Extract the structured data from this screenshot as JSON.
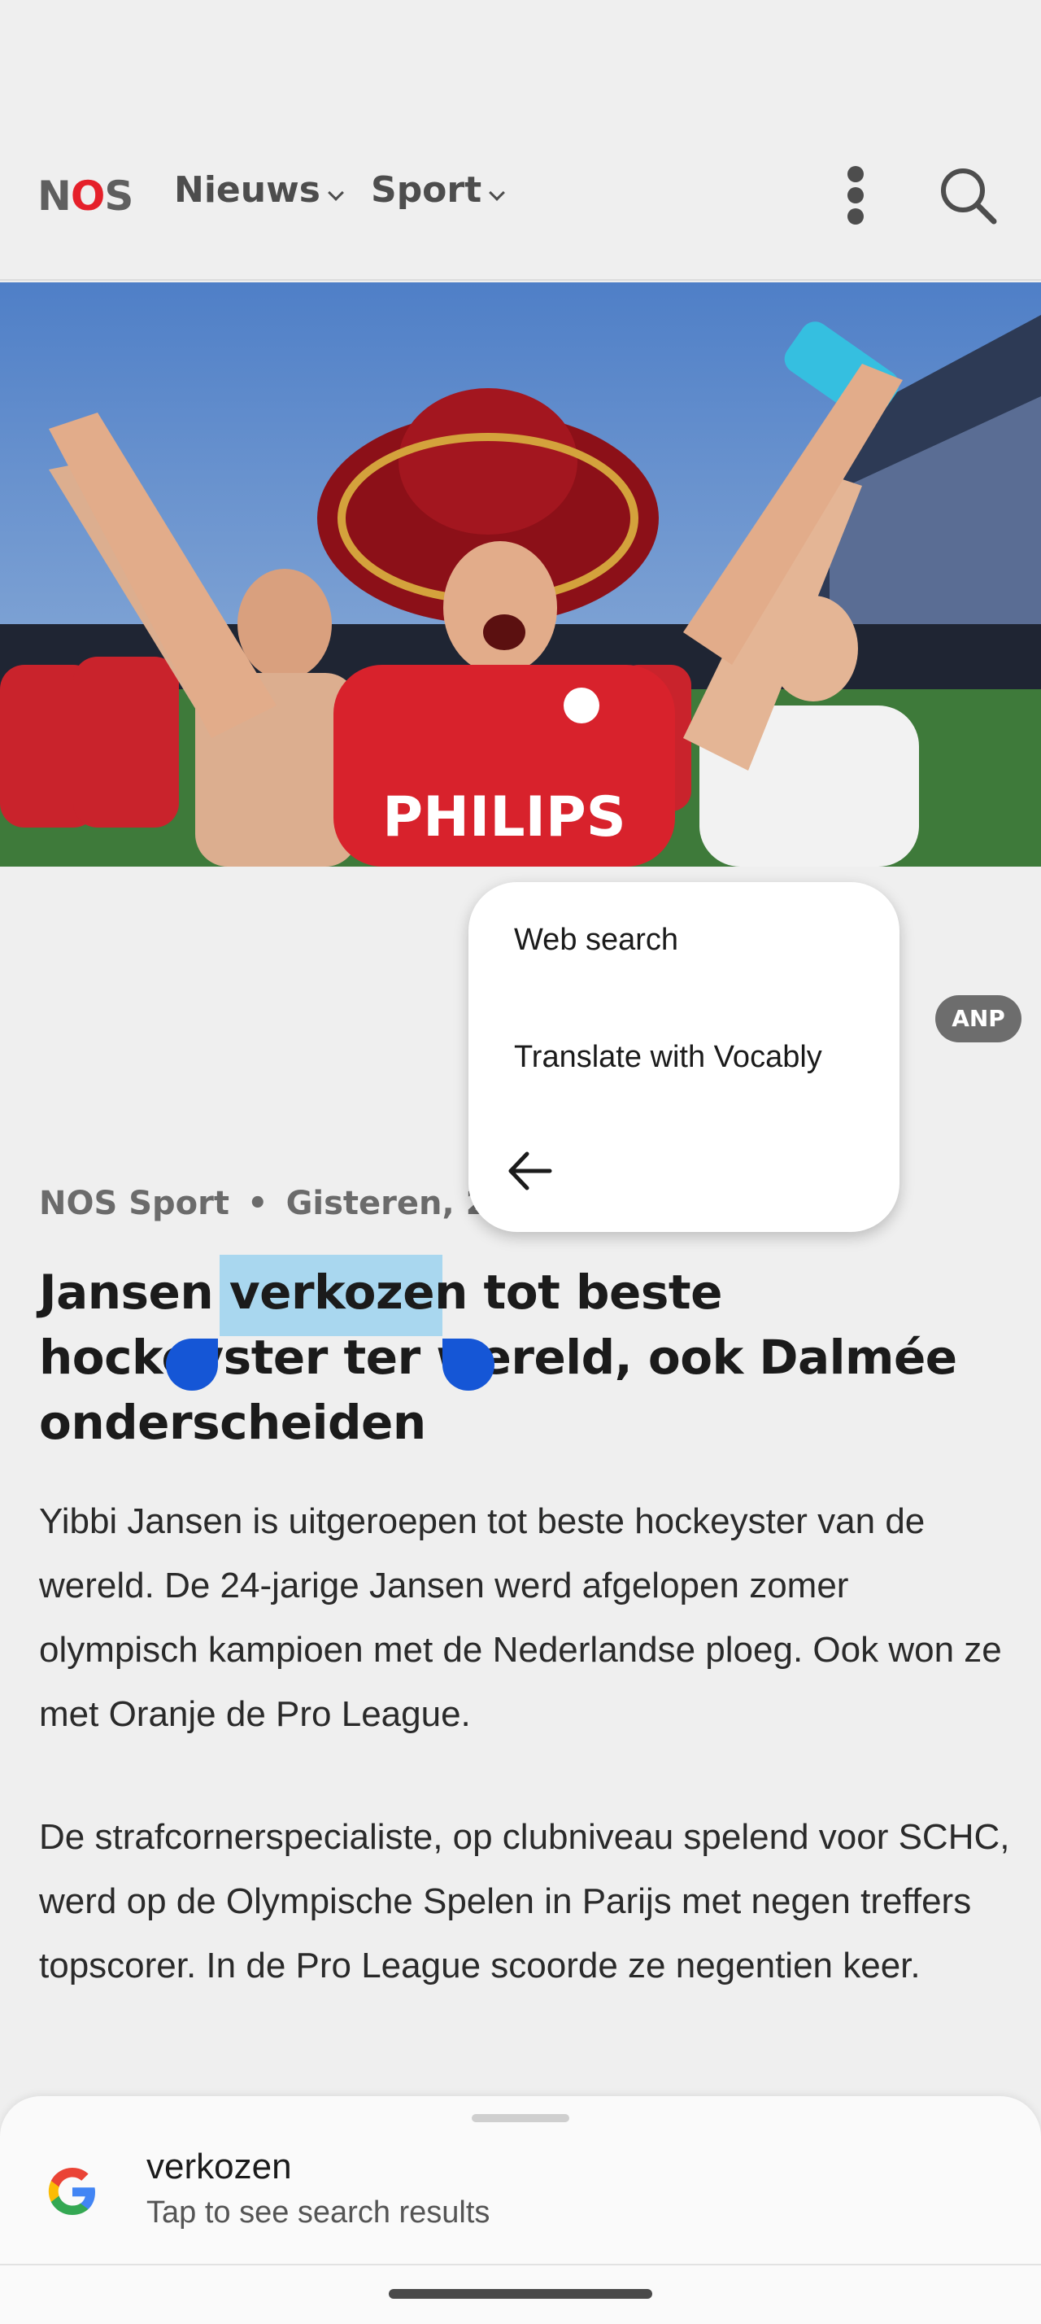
{
  "header": {
    "logo": {
      "n": "N",
      "o": "O",
      "s": "S"
    },
    "nav": [
      {
        "label": "Nieuws"
      },
      {
        "label": "Sport"
      }
    ]
  },
  "hero": {
    "shirt_text": "PHILIPS",
    "badge": "ANP"
  },
  "context_menu": {
    "items": [
      "Web search",
      "Translate with Vocably"
    ]
  },
  "article": {
    "source": "NOS Sport",
    "time": "Gisteren, 20",
    "headline_before": "Jansen ",
    "headline_selected": "verkozen",
    "headline_after": " tot beste hockeyster ter wereld, ook Dalmée onderscheiden",
    "paragraphs": [
      "Yibbi Jansen is uitgeroepen tot beste hockeyster van de wereld. De 24-jarige Jansen werd afgelopen zomer olympisch kampioen met de Nederlandse ploeg. Ook won ze met Oranje de Pro League.",
      "De strafcornerspecialiste, op clubniveau spelend voor SCHC, werd op de Olympische Spelen in Parijs met negen treffers topscorer. In de Pro League scoorde ze negentien keer."
    ]
  },
  "bottom_sheet": {
    "term": "verkozen",
    "subtitle": "Tap to see search results"
  },
  "colors": {
    "selection": "#a9d7ef",
    "handle": "#1556d6",
    "logo_accent": "#e5202a"
  }
}
